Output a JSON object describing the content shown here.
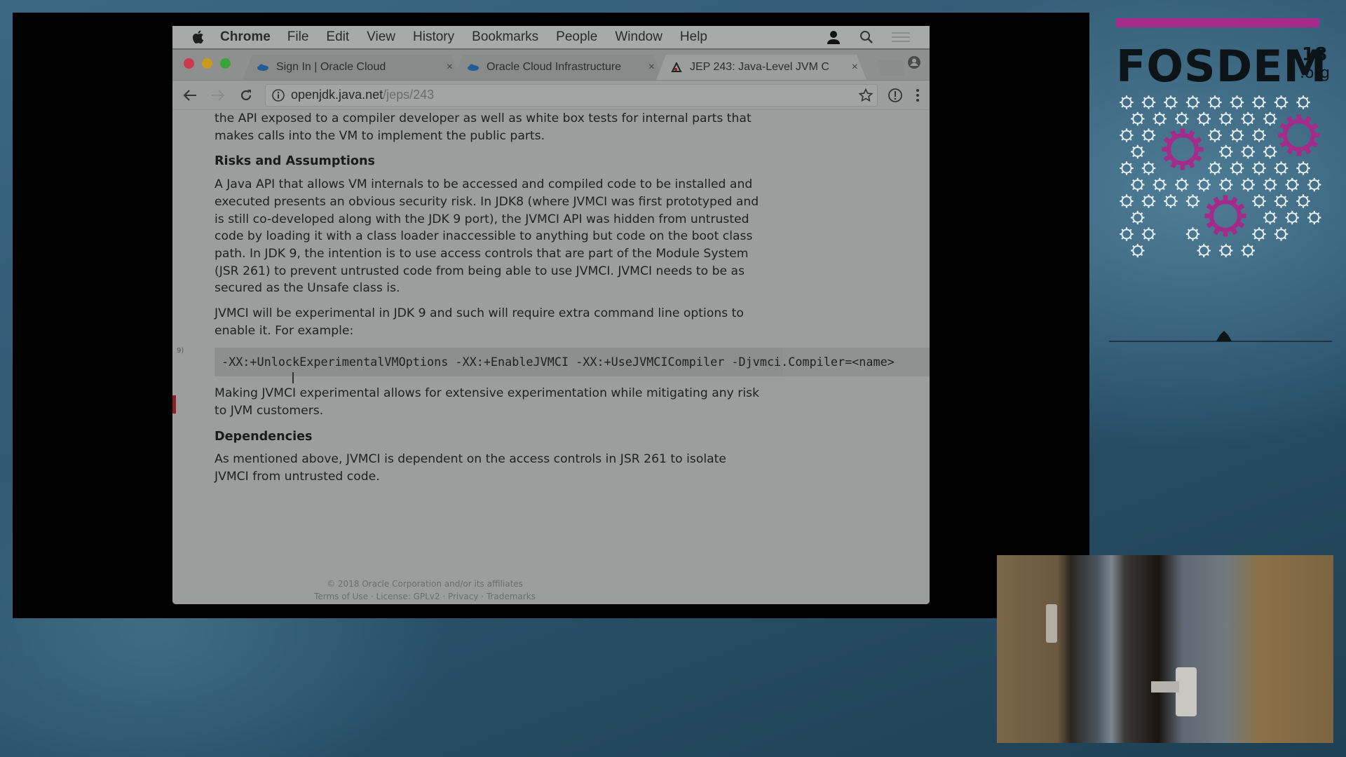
{
  "mac_menu": {
    "app_name": "Chrome",
    "items": [
      "File",
      "Edit",
      "View",
      "History",
      "Bookmarks",
      "People",
      "Window",
      "Help"
    ],
    "right_icons": [
      "user-icon",
      "spotlight-search-icon",
      "notification-list-icon"
    ]
  },
  "browser": {
    "traffic_colors": [
      "#c93a4a",
      "#c99a1e",
      "#3aa43a"
    ],
    "tabs": [
      {
        "title": "Sign In | Oracle Cloud",
        "icon": "oracle-cloud-icon",
        "active": false,
        "close": "×"
      },
      {
        "title": "Oracle Cloud Infrastructure",
        "icon": "oracle-cloud-icon",
        "active": false,
        "close": "×"
      },
      {
        "title": "JEP 243: Java-Level JVM C",
        "icon": "openjdk-duke-icon",
        "active": true,
        "close": "×"
      }
    ],
    "url": {
      "host": "openjdk.java.net",
      "path": "/jeps/243"
    }
  },
  "page": {
    "intro_para": "the API exposed to a compiler developer as well as white box tests for internal parts that makes calls into the VM to implement the public parts.",
    "section1_heading": "Risks and Assumptions",
    "section1_para": "A Java API that allows VM internals to be accessed and compiled code to be installed and executed presents an obvious security risk. In JDK8 (where JVMCI was first prototyped and is still co-developed along with the JDK 9 port), the JVMCI API was hidden from untrusted code by loading it with a class loader inaccessible to anything but code on the boot class path. In JDK 9, the intention is to use access controls that are part of the Module System (JSR 261) to prevent untrusted code from being able to use JVMCI. JVMCI needs to be as secured as the Unsafe class is.",
    "section1_para2": "JVMCI will be experimental in JDK 9 and such will require extra command line options to enable it. For example:",
    "code_example": "-XX:+UnlockExperimentalVMOptions -XX:+EnableJVMCI -XX:+UseJVMCICompiler -Djvmci.Compiler=<name>",
    "section1_para3": "Making JVMCI experimental allows for extensive experimentation while mitigating any risk to JVM customers.",
    "section2_heading": "Dependencies",
    "section2_para": "As mentioned above, JVMCI is dependent on the access controls in JSR 261 to isolate JVMCI from untrusted code.",
    "footer_copyright": "© 2018 Oracle Corporation and/or its affiliates",
    "footer_links": "Terms of Use · License: GPLv2 · Privacy · Trademarks",
    "gutter_label": "9)"
  },
  "fosdem": {
    "logo": "FOSDEM",
    "year": "18",
    "tld": ".org",
    "accent": "#a62a89"
  }
}
